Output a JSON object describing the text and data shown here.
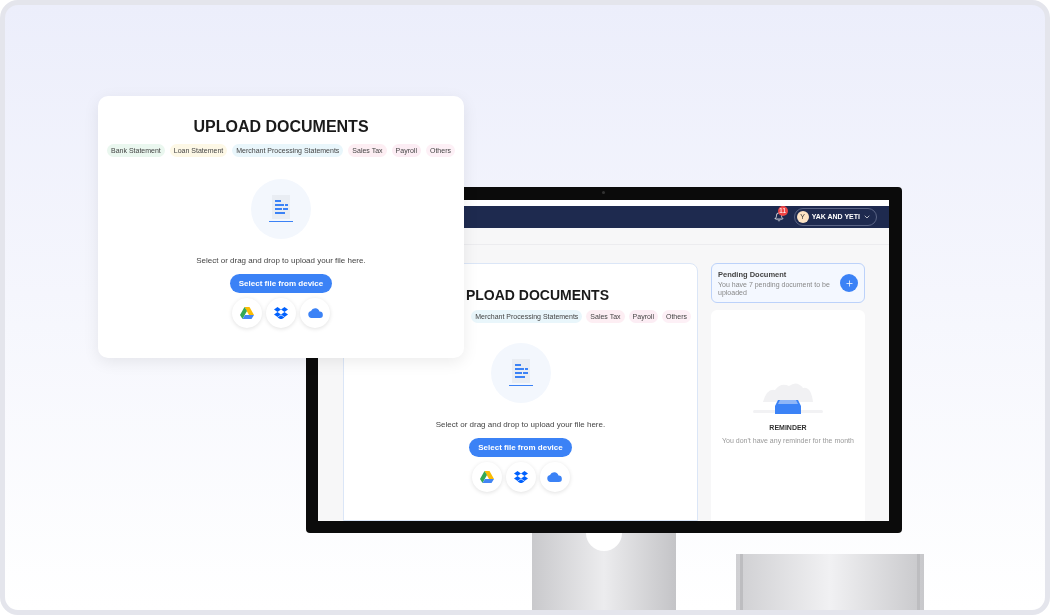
{
  "upload_card": {
    "title": "UPLOAD DOCUMENTS",
    "tags": [
      {
        "label": "Bank Statement",
        "color": "#eaf7ef"
      },
      {
        "label": "Loan Statement",
        "color": "#fdf8e6"
      },
      {
        "label": "Merchant Processing Statements",
        "color": "#e9f6fb"
      },
      {
        "label": "Sales Tax",
        "color": "#fdeef3"
      },
      {
        "label": "Payroll",
        "color": "#fcedf4"
      },
      {
        "label": "Others",
        "color": "#fdf0f6"
      }
    ],
    "prompt": "Select or drag and drop to upload your file here.",
    "button": "Select file from device",
    "sources": [
      {
        "kind": "drive"
      },
      {
        "kind": "dropbox"
      },
      {
        "kind": "cloud"
      }
    ]
  },
  "monitor_screen": {
    "header": {
      "notifications": "11",
      "avatar": "Y",
      "account": "YAK AND YETI"
    },
    "upload_card": {
      "title": "PLOAD DOCUMENTS",
      "tags": [
        {
          "label": "Merchant Processing Statements",
          "color": "#e9f6fb"
        },
        {
          "label": "Sales Tax",
          "color": "#fdeef3"
        },
        {
          "label": "Payroll",
          "color": "#fcedf4"
        },
        {
          "label": "Others",
          "color": "#fdf0f6"
        }
      ],
      "prompt": "Select or drag and drop to upload your file here.",
      "button": "Select file from device",
      "sources": [
        {
          "kind": "drive"
        },
        {
          "kind": "dropbox"
        },
        {
          "kind": "cloud"
        }
      ]
    },
    "pending": {
      "title": "Pending Document",
      "subtitle": "You have 7 pending document to be uploaded"
    },
    "reminder": {
      "title": "REMINDER",
      "message": "You don't have any reminder for the month"
    }
  }
}
